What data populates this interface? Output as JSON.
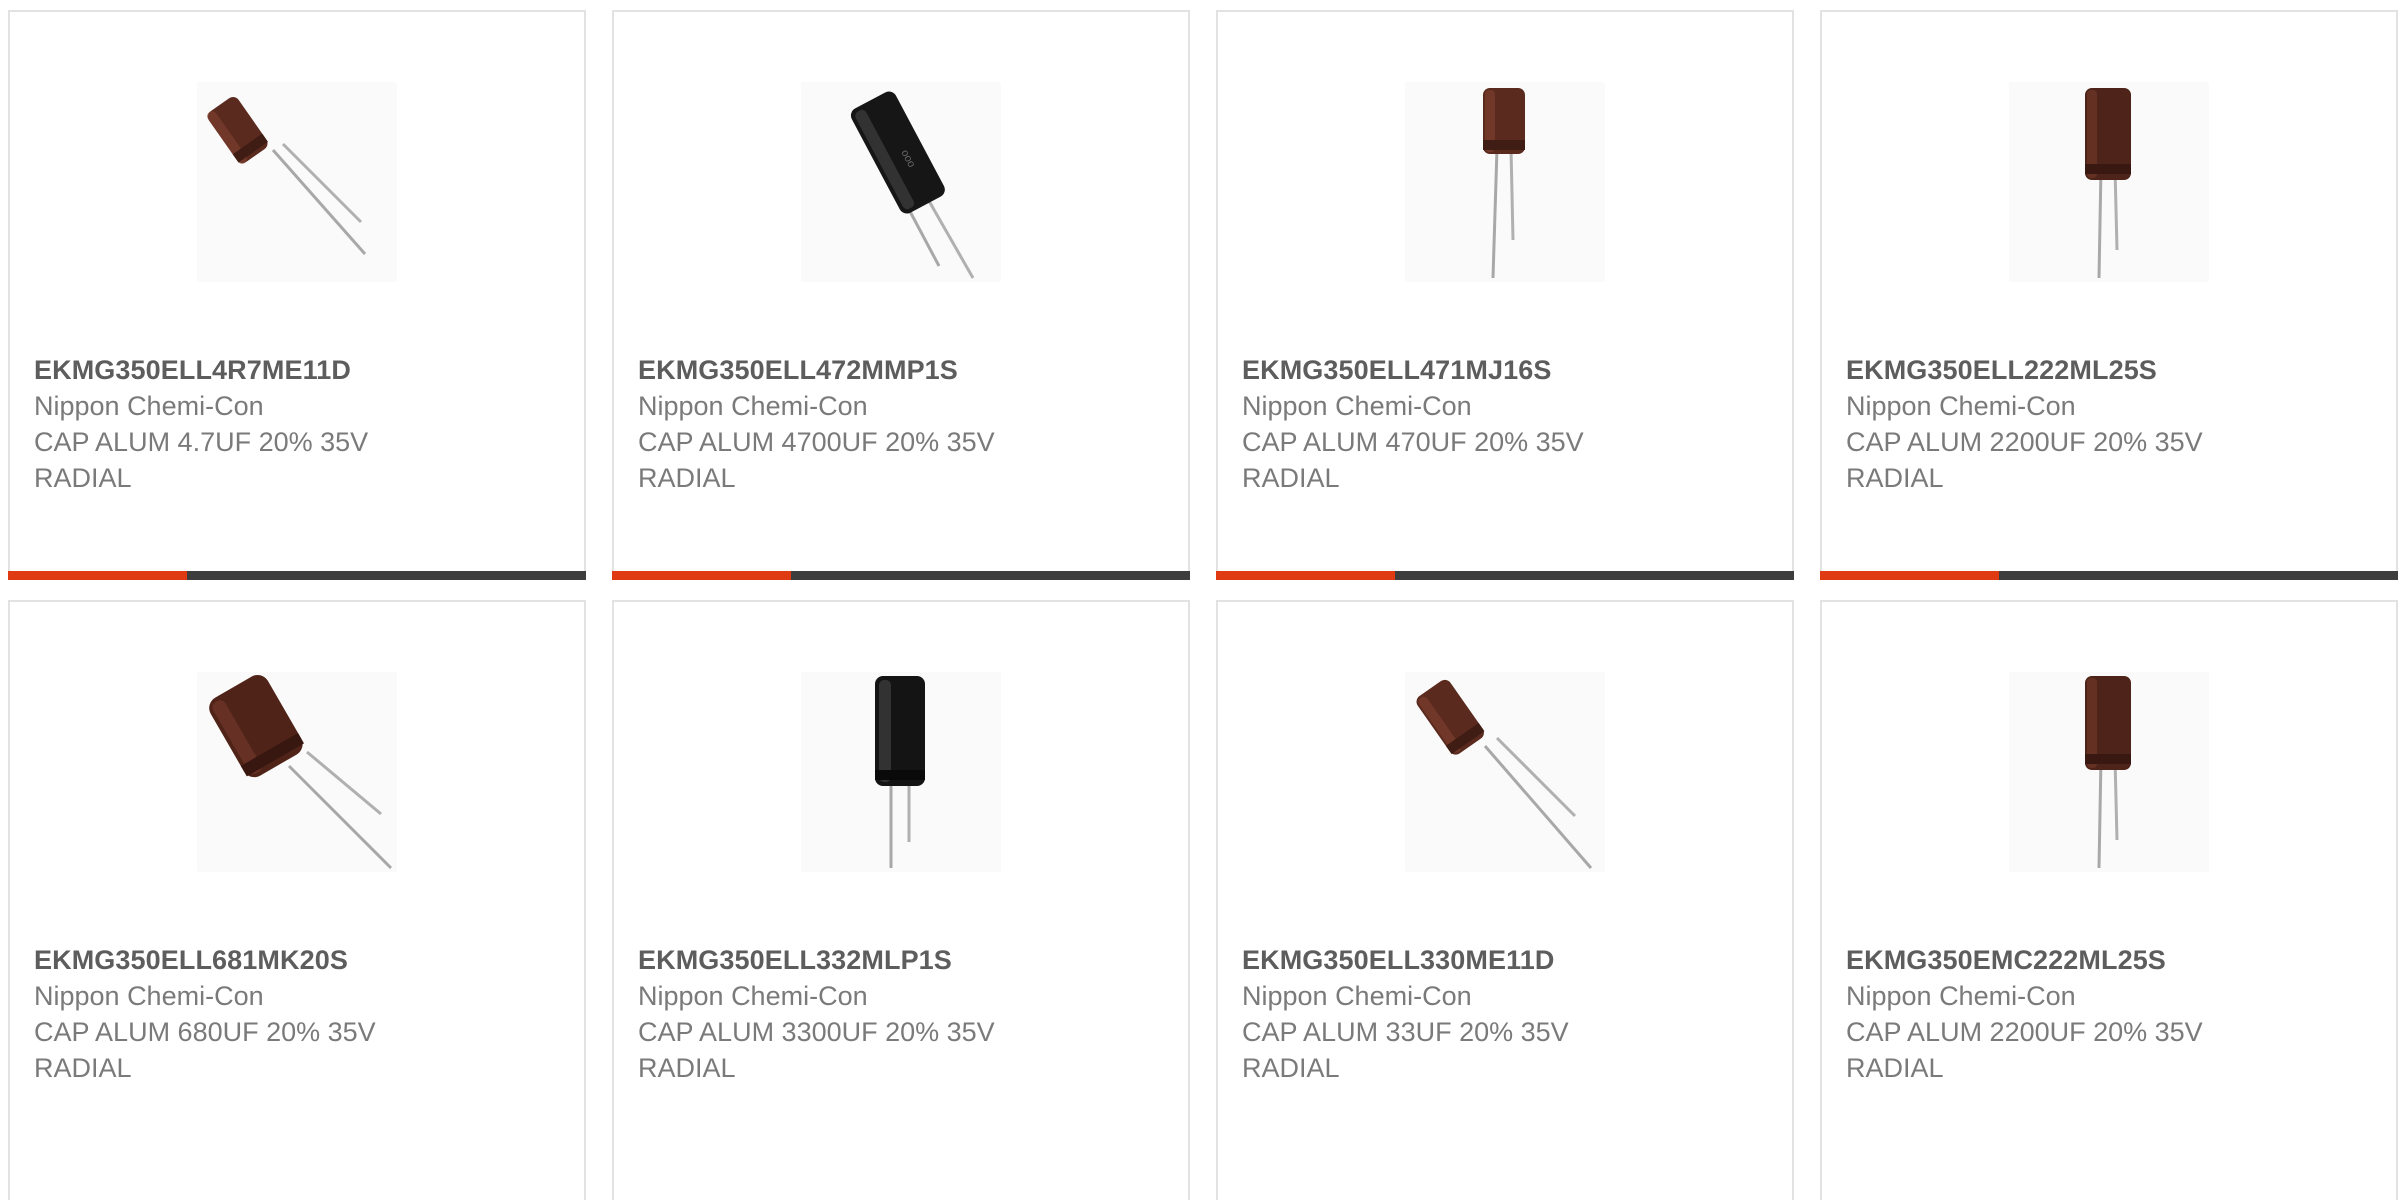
{
  "colors": {
    "accent": "#e03a13",
    "bar_track": "#3d3d3d",
    "border": "#e2e2e2",
    "title_text": "#5d5d5d",
    "body_text": "#7a7a7a"
  },
  "products": [
    {
      "part_number": "EKMG350ELL4R7ME11D",
      "manufacturer": "Nippon Chemi-Con",
      "description": "CAP ALUM 4.7UF 20% 35V RADIAL",
      "image": "brown-radial-capacitor-tilted",
      "progress": 0.31
    },
    {
      "part_number": "EKMG350ELL472MMP1S",
      "manufacturer": "Nippon Chemi-Con",
      "description": "CAP ALUM 4700UF 20% 35V RADIAL",
      "image": "black-radial-capacitor-tilted",
      "progress": 0.31
    },
    {
      "part_number": "EKMG350ELL471MJ16S",
      "manufacturer": "Nippon Chemi-Con",
      "description": "CAP ALUM 470UF 20% 35V RADIAL",
      "image": "brown-radial-capacitor-upright",
      "progress": 0.31
    },
    {
      "part_number": "EKMG350ELL222ML25S",
      "manufacturer": "Nippon Chemi-Con",
      "description": "CAP ALUM 2200UF 20% 35V RADIAL",
      "image": "brown-radial-capacitor-upright",
      "progress": 0.31
    },
    {
      "part_number": "EKMG350ELL681MK20S",
      "manufacturer": "Nippon Chemi-Con",
      "description": "CAP ALUM 680UF 20% 35V RADIAL",
      "image": "brown-radial-capacitor-tilted-wide",
      "progress": null
    },
    {
      "part_number": "EKMG350ELL332MLP1S",
      "manufacturer": "Nippon Chemi-Con",
      "description": "CAP ALUM 3300UF 20% 35V RADIAL",
      "image": "black-radial-capacitor-upright",
      "progress": null
    },
    {
      "part_number": "EKMG350ELL330ME11D",
      "manufacturer": "Nippon Chemi-Con",
      "description": "CAP ALUM 33UF 20% 35V RADIAL",
      "image": "brown-radial-capacitor-tilted",
      "progress": null
    },
    {
      "part_number": "EKMG350EMC222ML25S",
      "manufacturer": "Nippon Chemi-Con",
      "description": "CAP ALUM 2200UF 20% 35V RADIAL",
      "image": "brown-radial-capacitor-upright",
      "progress": null
    }
  ]
}
